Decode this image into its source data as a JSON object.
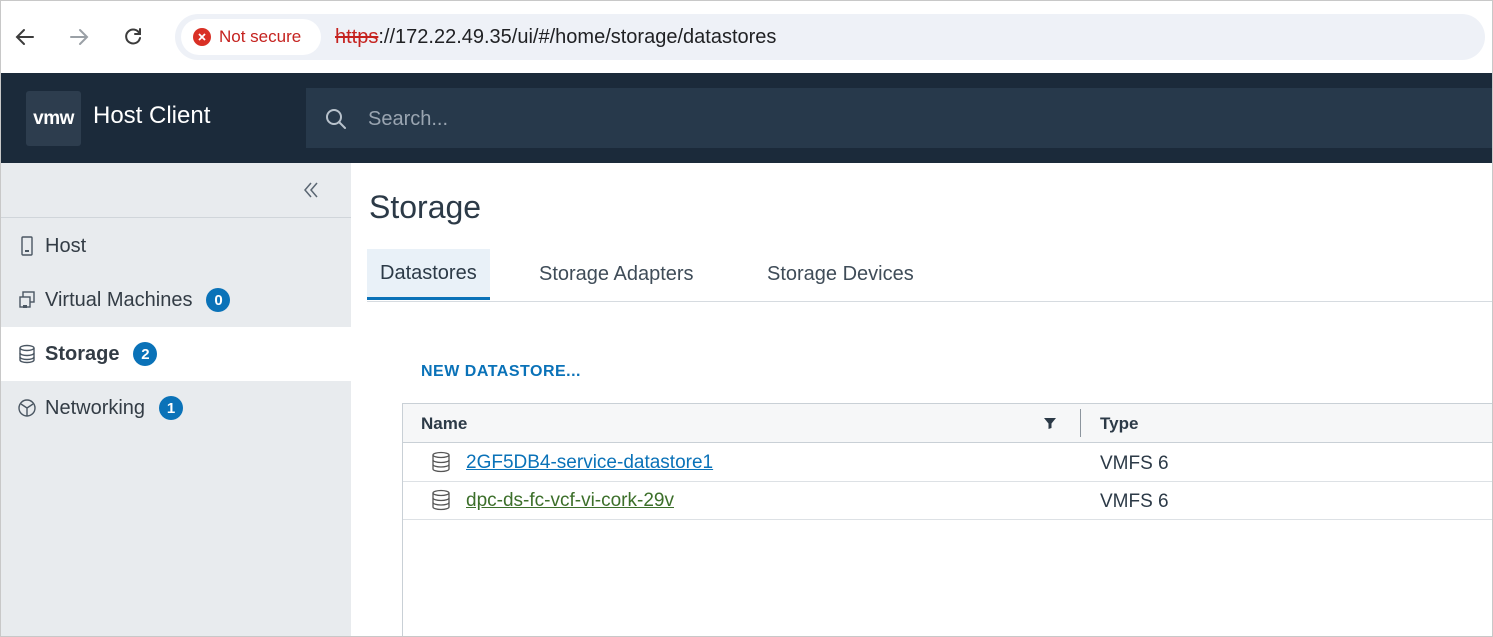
{
  "browser": {
    "security_label": "Not secure",
    "url_scheme": "https",
    "url_rest": "://172.22.49.35/ui/#/home/storage/datastores"
  },
  "header": {
    "logo": "vmw",
    "title": "Host Client",
    "search_placeholder": "Search..."
  },
  "sidebar": {
    "items": [
      {
        "label": "Host"
      },
      {
        "label": "Virtual Machines",
        "badge": "0"
      },
      {
        "label": "Storage",
        "badge": "2"
      },
      {
        "label": "Networking",
        "badge": "1"
      }
    ]
  },
  "main": {
    "title": "Storage",
    "tabs": [
      {
        "label": "Datastores"
      },
      {
        "label": "Storage Adapters"
      },
      {
        "label": "Storage Devices"
      }
    ],
    "new_datastore_label": "NEW DATASTORE...",
    "table": {
      "columns": [
        "Name",
        "Type"
      ],
      "rows": [
        {
          "name": "2GF5DB4-service-datastore1",
          "type": "VMFS 6"
        },
        {
          "name": "dpc-ds-fc-vcf-vi-cork-29v",
          "type": "VMFS 6"
        }
      ]
    }
  },
  "colors": {
    "header_bg": "#1b2a3a",
    "accent": "#0a72b8",
    "highlight": "#f5f51c"
  }
}
